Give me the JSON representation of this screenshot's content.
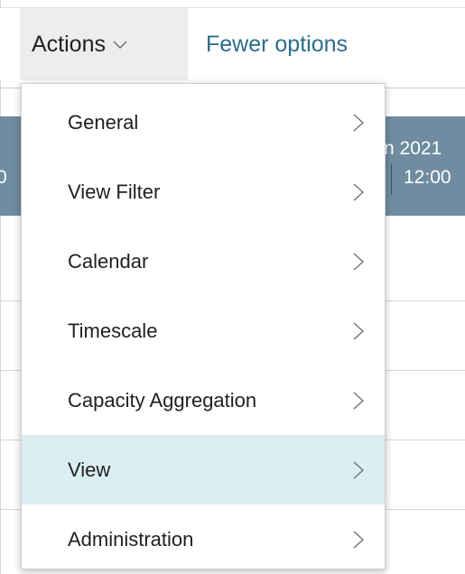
{
  "actions_bar": {
    "actions_label": "Actions",
    "actions_icon": "chevron-down-icon",
    "fewer_options_label": "Fewer options"
  },
  "background": {
    "date_header": "n 2021",
    "time_header": "12:00",
    "left_time_fragment": "0"
  },
  "menu": {
    "items": [
      {
        "label": "General",
        "icon": "chevron-right-icon"
      },
      {
        "label": "View Filter",
        "icon": "chevron-right-icon"
      },
      {
        "label": "Calendar",
        "icon": "chevron-right-icon"
      },
      {
        "label": "Timescale",
        "icon": "chevron-right-icon"
      },
      {
        "label": "Capacity Aggregation",
        "icon": "chevron-right-icon"
      },
      {
        "label": "View",
        "icon": "chevron-right-icon",
        "highlighted": true
      },
      {
        "label": "Administration",
        "icon": "chevron-right-icon"
      }
    ]
  },
  "colors": {
    "accent_link": "#2c6d8c",
    "header_band": "#6f8ca0",
    "highlight_row": "#dbeef1",
    "actions_tab_bg": "#ededed"
  }
}
